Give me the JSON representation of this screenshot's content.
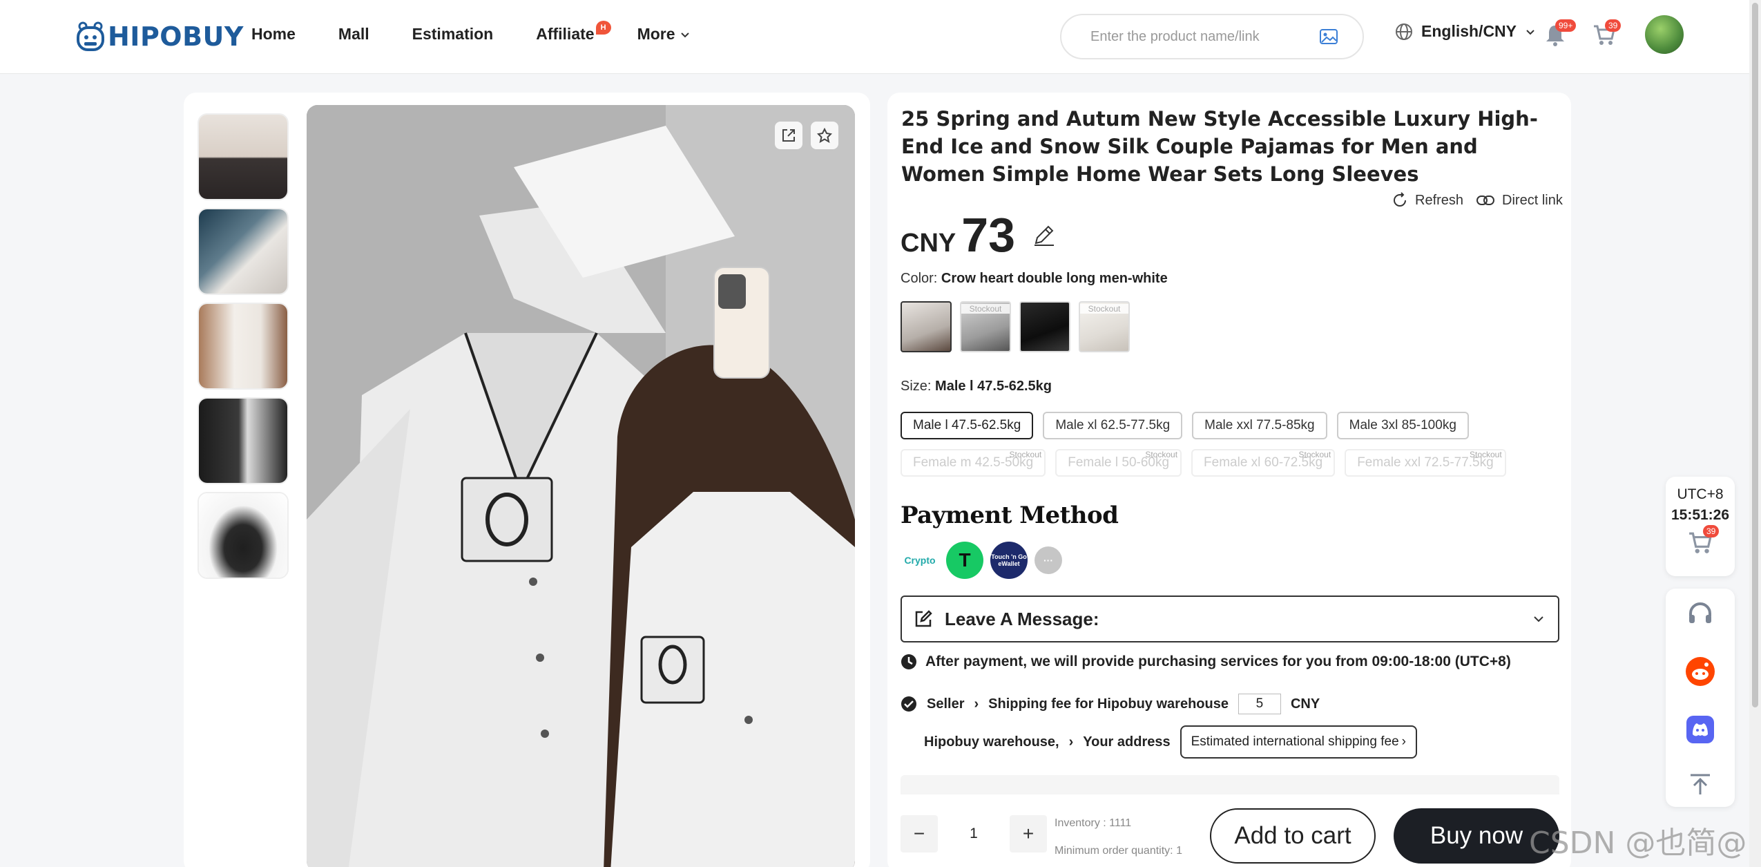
{
  "brand": {
    "name": "HIPOBUY"
  },
  "nav": [
    {
      "label": "Home"
    },
    {
      "label": "Mall"
    },
    {
      "label": "Estimation"
    },
    {
      "label": "Affiliate",
      "badge": "H"
    },
    {
      "label": "More"
    }
  ],
  "search": {
    "placeholder": "Enter the product name/link"
  },
  "header": {
    "language": "English/CNY",
    "notif_badge": "99+",
    "cart_badge": "39"
  },
  "product": {
    "title": "25 Spring and Autum New Style Accessible Luxury High-End Ice and Snow Silk Couple Pajamas for Men and Women Simple Home Wear Sets Long Sleeves",
    "refresh_label": "Refresh",
    "direct_link_label": "Direct link",
    "currency": "CNY",
    "price": "73",
    "color_label": "Color:",
    "color_value": "Crow heart double long men-white",
    "swatches": [
      {
        "stockout": ""
      },
      {
        "stockout": "Stockout"
      },
      {
        "stockout": ""
      },
      {
        "stockout": "Stockout"
      }
    ],
    "size_label": "Size:",
    "size_value": "Male l 47.5-62.5kg",
    "sizes": [
      {
        "label": "Male l 47.5-62.5kg",
        "stockout": ""
      },
      {
        "label": "Male xl 62.5-77.5kg",
        "stockout": ""
      },
      {
        "label": "Male xxl 77.5-85kg",
        "stockout": ""
      },
      {
        "label": "Male 3xl 85-100kg",
        "stockout": ""
      },
      {
        "label": "Female m 42.5-50kg",
        "stockout": "Stockout"
      },
      {
        "label": "Female l 50-60kg",
        "stockout": "Stockout"
      },
      {
        "label": "Female xl 60-72.5kg",
        "stockout": "Stockout"
      },
      {
        "label": "Female xxl 72.5-77.5kg",
        "stockout": "Stockout"
      }
    ]
  },
  "payment": {
    "title": "Payment Method",
    "methods": [
      {
        "label": "Crypto"
      },
      {
        "label": "T"
      },
      {
        "label": "Touch 'n Go eWallet"
      },
      {
        "label": "···"
      }
    ]
  },
  "message": {
    "label": "Leave A Message:"
  },
  "notice": "After payment, we will provide purchasing services for you from 09:00-18:00 (UTC+8)",
  "flow": {
    "seller": "Seller",
    "shipping_fee_label": "Shipping fee for Hipobuy warehouse",
    "shipping_fee_value": "5",
    "shipping_fee_currency": "CNY",
    "warehouse": "Hipobuy warehouse,",
    "address": "Your address",
    "estimate_button": "Estimated international shipping fee"
  },
  "order": {
    "quantity": "1",
    "inventory": "Inventory : 1111",
    "min_order": "Minimum order quantity:  1",
    "add_to_cart": "Add to cart",
    "buy_now": "Buy now"
  },
  "sidebar": {
    "timezone": "UTC+8",
    "time": "15:51:26",
    "cart_badge": "39"
  },
  "watermark": "CSDN @也简@",
  "colors": {
    "brand": "#1e5b9b",
    "badge": "#f04b3c",
    "buy_button": "#1c1f25"
  }
}
